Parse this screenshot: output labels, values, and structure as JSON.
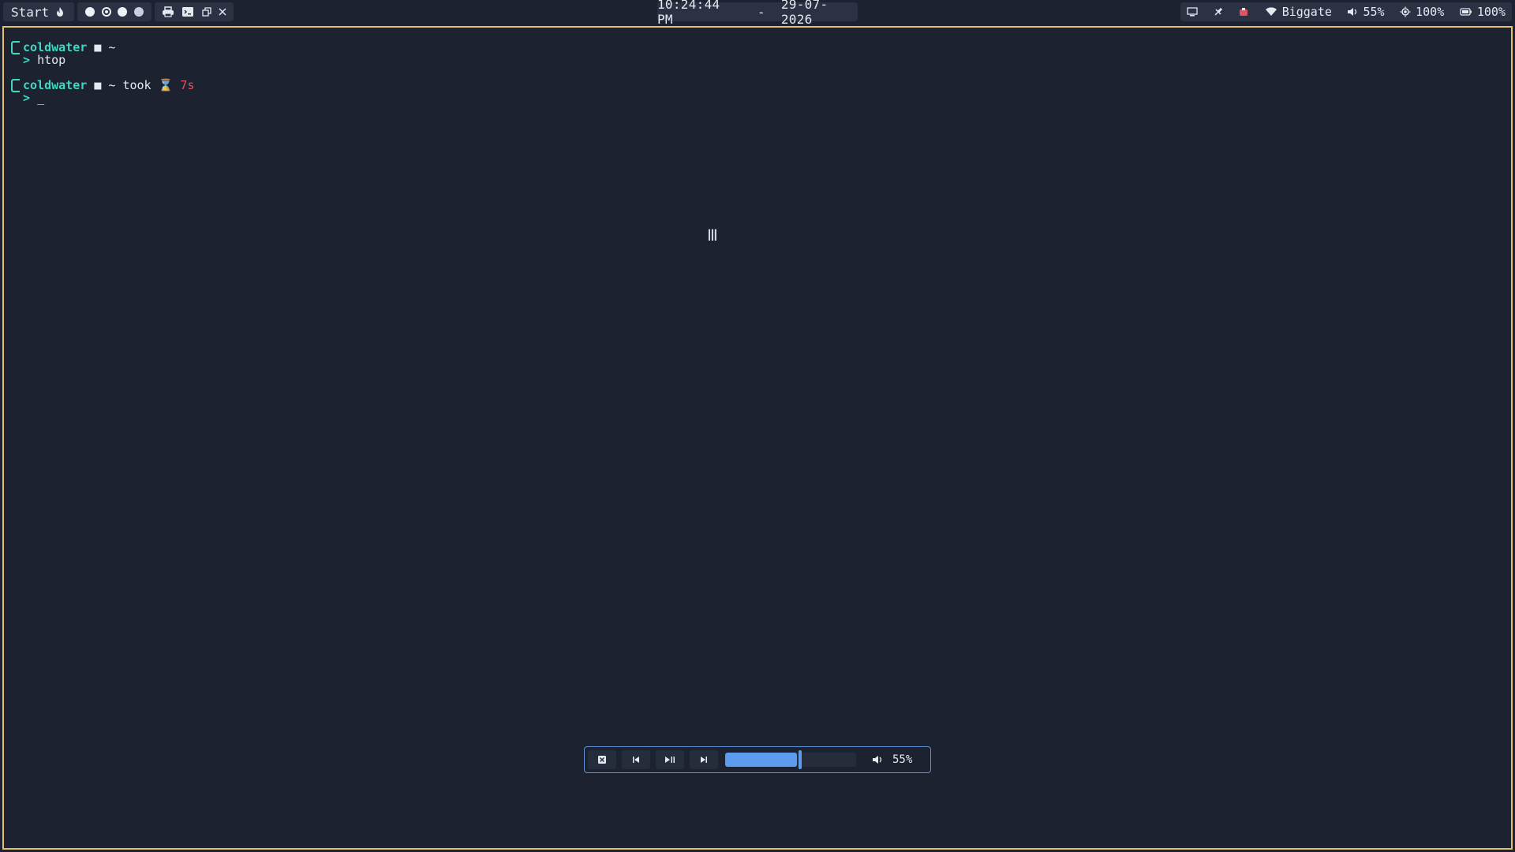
{
  "topbar": {
    "start_label": "Start",
    "clock": {
      "time": "10:24:44 PM",
      "separator": "-",
      "date": "29-07-2026"
    },
    "tray": {
      "network_name": "Biggate",
      "volume": "55%",
      "brightness": "100%",
      "battery": "100%"
    }
  },
  "terminal": {
    "lines": [
      {
        "user": "coldwater",
        "dir": "~",
        "command": "htop"
      },
      {
        "user": "coldwater",
        "dir": "~",
        "took_label": "took",
        "took_value": "7s",
        "command": "_"
      }
    ]
  },
  "media": {
    "volume": "55%",
    "progress_fraction": 0.55
  },
  "colors": {
    "accent": "#5d9bef",
    "prompt": "#3fd7c3",
    "warn": "#e0545f",
    "window_border": "#e2c070",
    "background": "#1c2230"
  },
  "icons": {
    "start": "flame-icon",
    "media_close": "close-box-icon",
    "prev": "skip-previous-icon",
    "play_pause": "play-pause-icon",
    "next": "skip-next-icon",
    "volume": "speaker-icon"
  }
}
